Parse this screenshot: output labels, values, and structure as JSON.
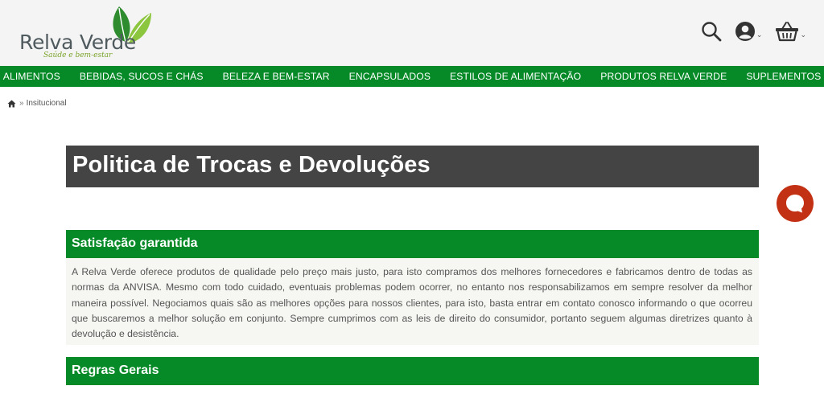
{
  "brand": {
    "name": "Relva Verde",
    "tagline": "Saúde e bem-estar"
  },
  "header": {
    "icons": [
      "search-icon",
      "user-icon",
      "basket-icon"
    ],
    "chevron": "⌄"
  },
  "nav": {
    "items": [
      {
        "label": "ALIMENTOS"
      },
      {
        "label": "BEBIDAS, SUCOS E CHÁS"
      },
      {
        "label": "BELEZA E BEM-ESTAR"
      },
      {
        "label": "ENCAPSULADOS"
      },
      {
        "label": "ESTILOS DE ALIMENTAÇÃO"
      },
      {
        "label": "PRODUTOS RELVA VERDE"
      },
      {
        "label": "SUPLEMENTOS"
      }
    ]
  },
  "breadcrumb": {
    "separator": "»",
    "current": "Insitucional"
  },
  "page": {
    "title": "Politica de Trocas e Devoluções"
  },
  "sections": [
    {
      "heading": "Satisfação garantida",
      "body": "A Relva Verde oferece produtos de qualidade pelo preço mais justo, para isto compramos dos melhores fornecedores e fabricamos dentro de todas as normas da ANVISA. Mesmo com todo cuidado, eventuais problemas podem ocorrer, no entanto nos responsabilizamos em sempre resolver da melhor maneira possível. Negociamos quais são as melhores opções para nossos clientes, para isto, basta entrar em contato conosco informando o que ocorreu que buscaremos a melhor solução em conjunto. Sempre cumprimos com as leis de direito do consumidor, portanto seguem algumas diretrizes quanto à devolução e desistência."
    },
    {
      "heading": "Regras Gerais"
    }
  ],
  "colors": {
    "brand_green": "#058a27",
    "title_bg": "#444444",
    "chat_red": "#c33115",
    "header_bg": "#f4f4f4"
  }
}
